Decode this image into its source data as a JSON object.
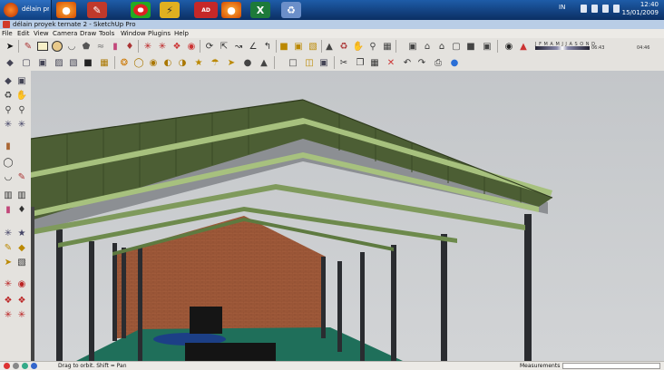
{
  "taskbar": {
    "start_label": "délain proyek ternate 2 - SketchUp Pro",
    "language": "IN",
    "time": "12:40",
    "date": "15/01/2009"
  },
  "window": {
    "title": "délain proyek ternate 2 - SketchUp Pro"
  },
  "menu": {
    "items": [
      "File",
      "Edit",
      "View",
      "Camera",
      "Draw",
      "Tools",
      "Window",
      "Plugins",
      "Help"
    ]
  },
  "shadow_settings": {
    "months": "J F M A M J J A S O N D",
    "time_start": "06:43",
    "time_end": "04:46"
  },
  "status": {
    "hint": "Drag to orbit.  Shift = Pan",
    "measurements_label": "Measurements",
    "measurements_value": ""
  },
  "colors": {
    "roof": "#4c5e34",
    "beam": "#a7c17e",
    "brick": "#a05a3a",
    "column": "#2a2c30",
    "floor": "#1f6f5a",
    "sky": "#c6c9cc"
  },
  "icons": {
    "taskbar": [
      "windows-orb-icon",
      "firefox-icon",
      "pencil-icon",
      "chrome-icon",
      "winamp-icon",
      "ad-icon",
      "firefox-icon",
      "excel-icon",
      "recycle-icon"
    ],
    "toolbar1": [
      "select-arrow-icon",
      "pencil-line-icon",
      "rectangle-icon",
      "circle-icon",
      "arc-icon",
      "polygon-icon",
      "freehand-icon",
      "eraser-icon",
      "paint-bucket-icon",
      "push-pull-icon",
      "follow-me-icon",
      "offset-icon",
      "move-icon",
      "rotate-icon",
      "scale-icon",
      "tape-measure-icon",
      "protractor-icon",
      "axes-icon",
      "dimension-icon",
      "text-icon",
      "3d-text-icon",
      "section-plane-icon",
      "orbit-icon",
      "pan-icon",
      "zoom-icon",
      "zoom-extents-icon",
      "house-icon",
      "camera-icon",
      "sun-icon",
      "shadow-bar-icon"
    ],
    "toolbar2": [
      "iso-view-icon",
      "top-view-icon",
      "front-view-icon",
      "right-view-icon",
      "back-view-icon",
      "left-view-icon",
      "xray-icon",
      "wireframe-icon",
      "hidden-line-icon",
      "shaded-icon",
      "shaded-texture-icon",
      "monochrome-icon",
      "model-info-icon",
      "new-file-icon",
      "open-file-icon",
      "save-icon",
      "cut-icon",
      "copy-icon",
      "paste-icon",
      "erase-icon",
      "undo-icon",
      "redo-icon",
      "print-icon",
      "help-icon"
    ]
  }
}
